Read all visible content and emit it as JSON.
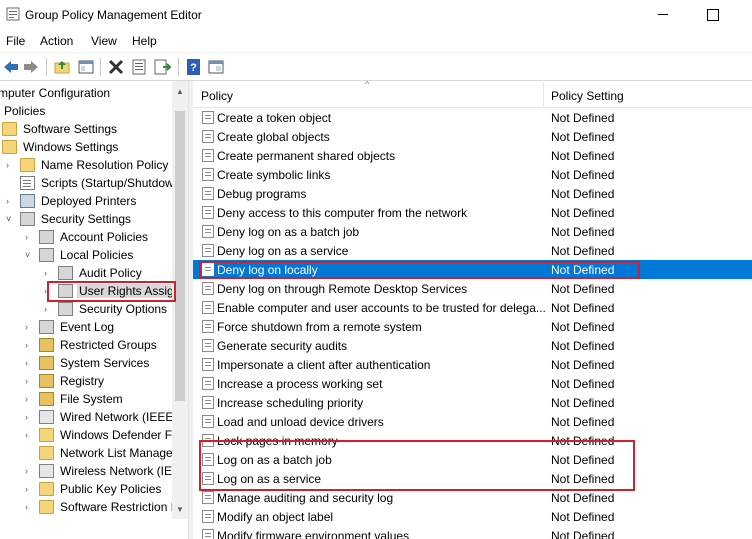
{
  "window": {
    "title": "Group Policy Management Editor",
    "minimize_icon": "minimize-icon",
    "maximize_icon": "maximize-icon"
  },
  "menu": [
    "File",
    "Action",
    "View",
    "Help"
  ],
  "toolbar_icons": [
    "back-arrow-icon",
    "forward-arrow-icon",
    "up-folder-icon",
    "show-hide-tree-icon",
    "delete-icon",
    "properties-icon",
    "export-list-icon",
    "help-icon",
    "console-view-icon"
  ],
  "tree": {
    "items": [
      {
        "label": "mputer Configuration",
        "icon": "none",
        "expander": ""
      },
      {
        "label": "Policies",
        "icon": "none",
        "expander": ""
      },
      {
        "label": "Software Settings",
        "icon": "folder-icon",
        "expander": ""
      },
      {
        "label": "Windows Settings",
        "icon": "folder-icon",
        "expander": ""
      },
      {
        "label": "Name Resolution Policy",
        "icon": "folder-icon",
        "expander": "›"
      },
      {
        "label": "Scripts (Startup/Shutdow",
        "icon": "script-icon",
        "expander": ""
      },
      {
        "label": "Deployed Printers",
        "icon": "printer-icon",
        "expander": "›"
      },
      {
        "label": "Security Settings",
        "icon": "security-icon",
        "expander": "˅"
      },
      {
        "label": "Account Policies",
        "icon": "security-icon",
        "expander": "›"
      },
      {
        "label": "Local Policies",
        "icon": "security-icon",
        "expander": "˅"
      },
      {
        "label": "Audit Policy",
        "icon": "security-icon",
        "expander": "›"
      },
      {
        "label": "User Rights Assig",
        "icon": "security-icon",
        "expander": "›"
      },
      {
        "label": "Security Options",
        "icon": "security-icon",
        "expander": "›"
      },
      {
        "label": "Event Log",
        "icon": "security-icon",
        "expander": "›"
      },
      {
        "label": "Restricted Groups",
        "icon": "lock-folder-icon",
        "expander": "›"
      },
      {
        "label": "System Services",
        "icon": "lock-folder-icon",
        "expander": "›"
      },
      {
        "label": "Registry",
        "icon": "lock-folder-icon",
        "expander": "›"
      },
      {
        "label": "File System",
        "icon": "lock-folder-icon",
        "expander": "›"
      },
      {
        "label": "Wired Network (IEEE",
        "icon": "network-icon",
        "expander": "›"
      },
      {
        "label": "Windows Defender F",
        "icon": "folder-icon",
        "expander": "›"
      },
      {
        "label": "Network List Manage",
        "icon": "folder-icon",
        "expander": ""
      },
      {
        "label": "Wireless Network (IEE",
        "icon": "network-icon",
        "expander": "›"
      },
      {
        "label": "Public Key Policies",
        "icon": "folder-icon",
        "expander": "›"
      },
      {
        "label": "Software Restriction P",
        "icon": "folder-icon",
        "expander": "›"
      }
    ]
  },
  "list": {
    "columns": {
      "policy": "Policy",
      "setting": "Policy Setting"
    },
    "rows": [
      {
        "policy": "Create a token object",
        "setting": "Not Defined"
      },
      {
        "policy": "Create global objects",
        "setting": "Not Defined"
      },
      {
        "policy": "Create permanent shared objects",
        "setting": "Not Defined"
      },
      {
        "policy": "Create symbolic links",
        "setting": "Not Defined"
      },
      {
        "policy": "Debug programs",
        "setting": "Not Defined"
      },
      {
        "policy": "Deny access to this computer from the network",
        "setting": "Not Defined"
      },
      {
        "policy": "Deny log on as a batch job",
        "setting": "Not Defined"
      },
      {
        "policy": "Deny log on as a service",
        "setting": "Not Defined"
      },
      {
        "policy": "Deny log on locally",
        "setting": "Not Defined"
      },
      {
        "policy": "Deny log on through Remote Desktop Services",
        "setting": "Not Defined"
      },
      {
        "policy": "Enable computer and user accounts to be trusted for delega...",
        "setting": "Not Defined"
      },
      {
        "policy": "Force shutdown from a remote system",
        "setting": "Not Defined"
      },
      {
        "policy": "Generate security audits",
        "setting": "Not Defined"
      },
      {
        "policy": "Impersonate a client after authentication",
        "setting": "Not Defined"
      },
      {
        "policy": "Increase a process working set",
        "setting": "Not Defined"
      },
      {
        "policy": "Increase scheduling priority",
        "setting": "Not Defined"
      },
      {
        "policy": "Load and unload device drivers",
        "setting": "Not Defined"
      },
      {
        "policy": "Lock pages in memory",
        "setting": "Not Defined"
      },
      {
        "policy": "Log on as a batch job",
        "setting": "Not Defined"
      },
      {
        "policy": "Log on as a service",
        "setting": "Not Defined"
      },
      {
        "policy": "Manage auditing and security log",
        "setting": "Not Defined"
      },
      {
        "policy": "Modify an object label",
        "setting": "Not Defined"
      },
      {
        "policy": "Modify firmware environment values",
        "setting": "Not Defined"
      }
    ]
  },
  "colors": {
    "selection": "#0078d7",
    "annotation": "#d0202e"
  }
}
